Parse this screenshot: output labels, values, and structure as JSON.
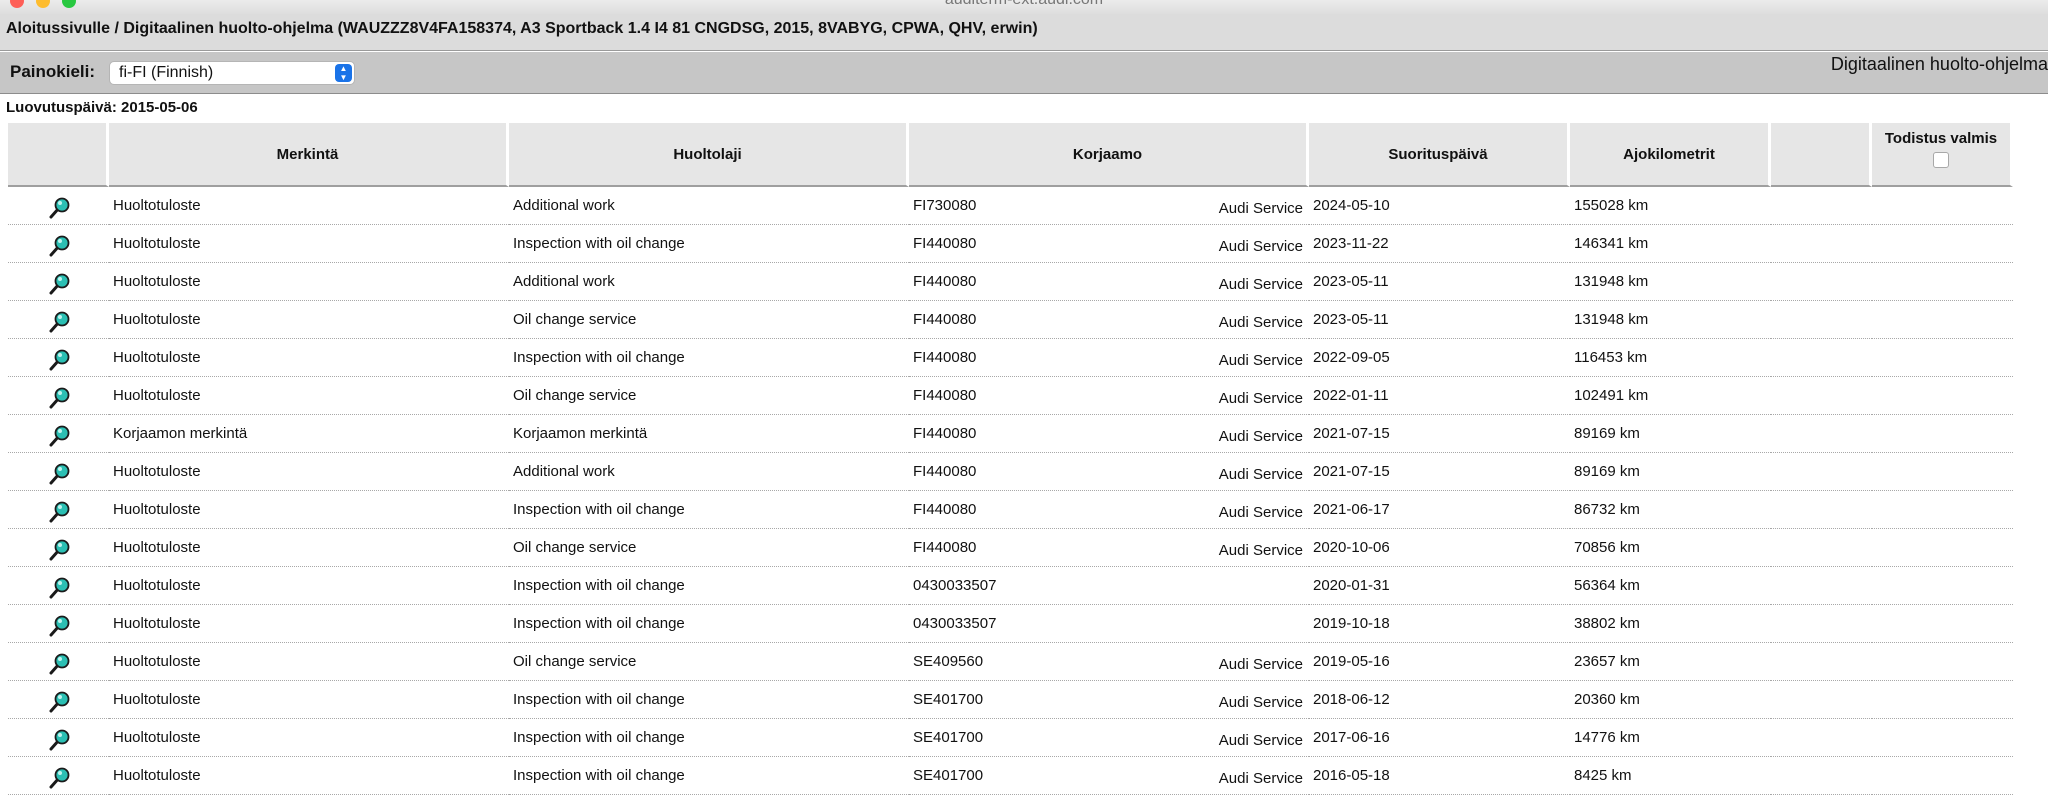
{
  "window": {
    "title": "auditerm-ext.audi.com"
  },
  "breadcrumb": "Aloitussivulle / Digitaalinen huolto-ohjelma (WAUZZZ8V4FA158374, A3 Sportback 1.4 I4 81 CNGDSG, 2015, 8VABYG, CPWA, QHV, erwin)",
  "toolbar": {
    "language_label": "Painokieli:",
    "language_value": "fi-FI (Finnish)",
    "app_title": "Digitaalinen huolto-ohjelma"
  },
  "delivery_date": "Luovutuspäivä: 2015-05-06",
  "table": {
    "headers": {
      "marking": "Merkintä",
      "service_type": "Huoltolaji",
      "workshop": "Korjaamo",
      "date": "Suorituspäivä",
      "km": "Ajokilometrit",
      "certificate": "Todistus valmis"
    },
    "rows": [
      {
        "marking": "Huoltotuloste",
        "service_type": "Additional work",
        "workshop_code": "FI730080",
        "workshop_name": "Audi Service",
        "date": "2024-05-10",
        "km": "155028 km"
      },
      {
        "marking": "Huoltotuloste",
        "service_type": "Inspection with oil change",
        "workshop_code": "FI440080",
        "workshop_name": "Audi Service",
        "date": "2023-11-22",
        "km": "146341 km"
      },
      {
        "marking": "Huoltotuloste",
        "service_type": "Additional work",
        "workshop_code": "FI440080",
        "workshop_name": "Audi Service",
        "date": "2023-05-11",
        "km": "131948 km"
      },
      {
        "marking": "Huoltotuloste",
        "service_type": "Oil change service",
        "workshop_code": "FI440080",
        "workshop_name": "Audi Service",
        "date": "2023-05-11",
        "km": "131948 km"
      },
      {
        "marking": "Huoltotuloste",
        "service_type": "Inspection with oil change",
        "workshop_code": "FI440080",
        "workshop_name": "Audi Service",
        "date": "2022-09-05",
        "km": "116453 km"
      },
      {
        "marking": "Huoltotuloste",
        "service_type": "Oil change service",
        "workshop_code": "FI440080",
        "workshop_name": "Audi Service",
        "date": "2022-01-11",
        "km": "102491 km"
      },
      {
        "marking": "Korjaamon merkintä",
        "service_type": "Korjaamon merkintä",
        "workshop_code": "FI440080",
        "workshop_name": "Audi Service",
        "date": "2021-07-15",
        "km": "89169 km"
      },
      {
        "marking": "Huoltotuloste",
        "service_type": "Additional work",
        "workshop_code": "FI440080",
        "workshop_name": "Audi Service",
        "date": "2021-07-15",
        "km": "89169 km"
      },
      {
        "marking": "Huoltotuloste",
        "service_type": "Inspection with oil change",
        "workshop_code": "FI440080",
        "workshop_name": "Audi Service",
        "date": "2021-06-17",
        "km": "86732 km"
      },
      {
        "marking": "Huoltotuloste",
        "service_type": "Oil change service",
        "workshop_code": "FI440080",
        "workshop_name": "Audi Service",
        "date": "2020-10-06",
        "km": "70856 km"
      },
      {
        "marking": "Huoltotuloste",
        "service_type": "Inspection with oil change",
        "workshop_code": "0430033507",
        "workshop_name": "",
        "date": "2020-01-31",
        "km": "56364 km"
      },
      {
        "marking": "Huoltotuloste",
        "service_type": "Inspection with oil change",
        "workshop_code": "0430033507",
        "workshop_name": "",
        "date": "2019-10-18",
        "km": "38802 km"
      },
      {
        "marking": "Huoltotuloste",
        "service_type": "Oil change service",
        "workshop_code": "SE409560",
        "workshop_name": "Audi Service",
        "date": "2019-05-16",
        "km": "23657 km"
      },
      {
        "marking": "Huoltotuloste",
        "service_type": "Inspection with oil change",
        "workshop_code": "SE401700",
        "workshop_name": "Audi Service",
        "date": "2018-06-12",
        "km": "20360 km"
      },
      {
        "marking": "Huoltotuloste",
        "service_type": "Inspection with oil change",
        "workshop_code": "SE401700",
        "workshop_name": "Audi Service",
        "date": "2017-06-16",
        "km": "14776 km"
      },
      {
        "marking": "Huoltotuloste",
        "service_type": "Inspection with oil change",
        "workshop_code": "SE401700",
        "workshop_name": "Audi Service",
        "date": "2016-05-18",
        "km": "8425 km"
      }
    ]
  },
  "icons": {
    "detail": "magnifier-icon"
  },
  "colors": {
    "select_accent": "#1a73e8",
    "magnifier_lens": "#2bbfb3"
  }
}
